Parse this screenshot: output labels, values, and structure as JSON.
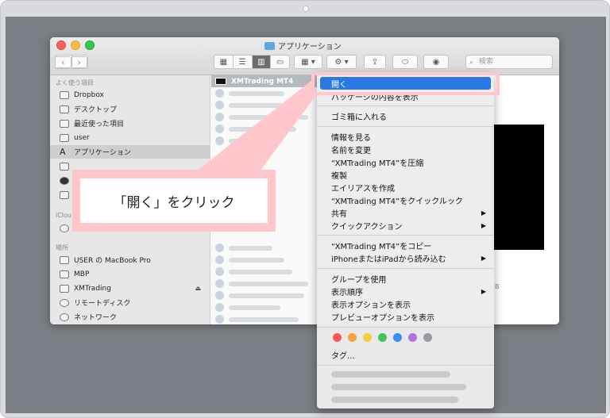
{
  "window": {
    "title": "アプリケーション",
    "search_placeholder": "検索"
  },
  "toolbar": {
    "back_icon": "chevron-left-icon",
    "forward_icon": "chevron-right-icon",
    "views": [
      "icon-view",
      "list-view",
      "column-view",
      "gallery-view"
    ],
    "arrange_label": "▾",
    "action_label": "▾"
  },
  "sidebar": {
    "favorites_title": "よく使う項目",
    "favorites": [
      {
        "label": "Dropbox",
        "icon": "folder-icon"
      },
      {
        "label": "デスクトップ",
        "icon": "folder-icon"
      },
      {
        "label": "最近使った項目",
        "icon": "clock-icon"
      },
      {
        "label": "user",
        "icon": "home-icon"
      },
      {
        "label": "アプリケーション",
        "icon": "applications-icon"
      }
    ],
    "icloud_title": "iClou",
    "locations_title": "場所",
    "locations": [
      {
        "label": "USER の MacBook Pro",
        "icon": "laptop-icon"
      },
      {
        "label": "MBP",
        "icon": "disk-icon"
      },
      {
        "label": "XMTrading",
        "icon": "disk-icon"
      },
      {
        "label": "リモートディスク",
        "icon": "disc-icon"
      },
      {
        "label": "ネットワーク",
        "icon": "globe-icon"
      }
    ]
  },
  "filelist": {
    "selected": "XMTrading MT4"
  },
  "preview": {
    "size_fragment": "B"
  },
  "context_menu": {
    "open": "開く",
    "show_package": "パッケージの内容を表示",
    "trash": "ゴミ箱に入れる",
    "get_info": "情報を見る",
    "rename": "名前を変更",
    "compress": "“XMTrading MT4”を圧縮",
    "duplicate": "複製",
    "make_alias": "エイリアスを作成",
    "quick_look": "“XMTrading MT4”をクイックルック",
    "share": "共有",
    "quick_actions": "クイックアクション",
    "copy": "“XMTrading MT4”をコピー",
    "import_iphone": "iPhoneまたはiPadから読み込む",
    "use_groups": "グループを使用",
    "sort_by": "表示順序",
    "show_view_options": "表示オプションを表示",
    "show_preview_options": "プレビューオプションを表示",
    "tags": "タグ...",
    "submenu_arrow": "▶"
  },
  "tag_colors": [
    "#fc5753",
    "#f7a33a",
    "#f5cd3f",
    "#44c25a",
    "#3a8ef6",
    "#b073d9",
    "#9a9a9e"
  ],
  "annotation": {
    "text": "「開く」をクリック",
    "color": "#ffc7cc"
  }
}
